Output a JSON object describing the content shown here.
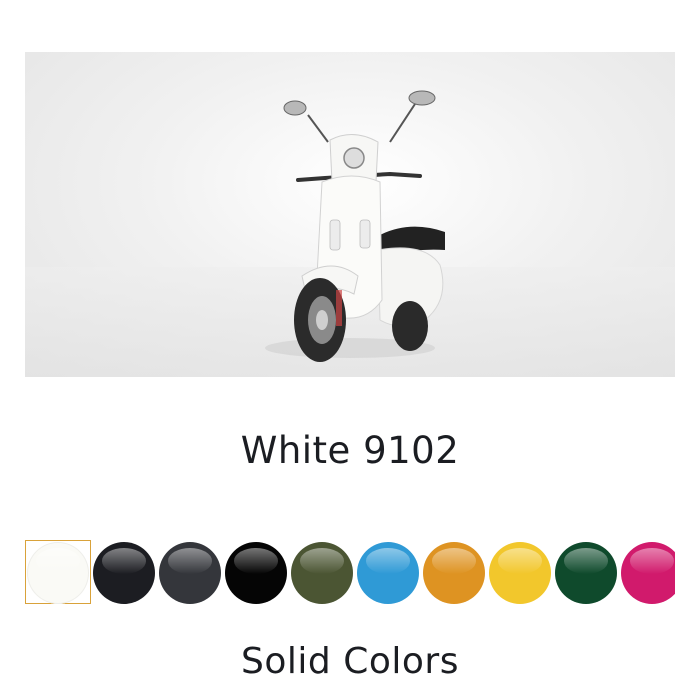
{
  "hero": {
    "image_alt": "Vespa scooter"
  },
  "selected_color": {
    "name": "White 9102"
  },
  "swatches": [
    {
      "name": "white",
      "color": "#fafaf6",
      "selected": true
    },
    {
      "name": "black-1",
      "color": "#1c1d22",
      "selected": false
    },
    {
      "name": "dark-gray",
      "color": "#34363b",
      "selected": false
    },
    {
      "name": "black-2",
      "color": "#050505",
      "selected": false
    },
    {
      "name": "olive-green",
      "color": "#4b5533",
      "selected": false
    },
    {
      "name": "sky-blue",
      "color": "#2f9ad6",
      "selected": false
    },
    {
      "name": "amber",
      "color": "#de9322",
      "selected": false
    },
    {
      "name": "yellow",
      "color": "#f2c72c",
      "selected": false
    },
    {
      "name": "forest-green",
      "color": "#0f4a2c",
      "selected": false
    },
    {
      "name": "magenta",
      "color": "#d11a6c",
      "selected": false
    }
  ],
  "category": {
    "label": "Solid Colors"
  }
}
